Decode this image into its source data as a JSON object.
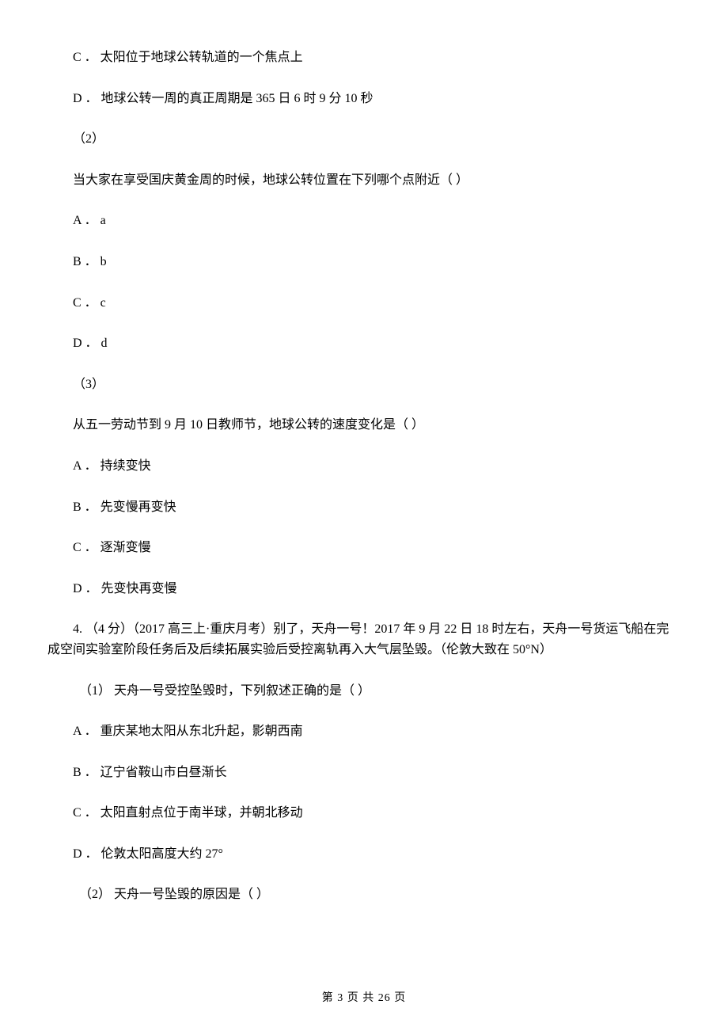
{
  "q3": {
    "part1": {
      "optC": "C ． 太阳位于地球公转轨道的一个焦点上",
      "optD": "D ． 地球公转一周的真正周期是 365 日 6 时 9 分 10 秒"
    },
    "part2": {
      "label": "（2）",
      "stem": "当大家在享受国庆黄金周的时候，地球公转位置在下列哪个点附近（    ）",
      "optA": "A ． a",
      "optB": "B ． b",
      "optC": "C ． c",
      "optD": "D ． d"
    },
    "part3": {
      "label": "（3）",
      "stem": "从五一劳动节到 9 月 10 日教师节，地球公转的速度变化是（    ）",
      "optA": "A ． 持续变快",
      "optB": "B ． 先变慢再变快",
      "optC": "C ． 逐渐变慢",
      "optD": "D ． 先变快再变慢"
    }
  },
  "q4": {
    "intro": "4. （4 分）（2017 高三上·重庆月考）别了，天舟一号！2017 年 9 月 22 日 18 时左右，天舟一号货运飞船在完成空间实验室阶段任务后及后续拓展实验后受控离轨再入大气层坠毁。（伦敦大致在 50°N）",
    "part1": {
      "stem": "（1） 天舟一号受控坠毁时，下列叙述正确的是（    ）",
      "optA": "A ． 重庆某地太阳从东北升起，影朝西南",
      "optB": "B ． 辽宁省鞍山市白昼渐长",
      "optC": "C ． 太阳直射点位于南半球，并朝北移动",
      "optD": "D ． 伦敦太阳高度大约 27°"
    },
    "part2": {
      "stem": "（2） 天舟一号坠毁的原因是（    ）"
    }
  },
  "footer": "第 3 页 共 26 页"
}
